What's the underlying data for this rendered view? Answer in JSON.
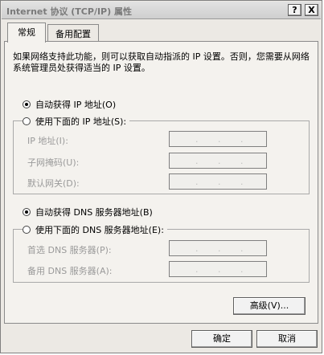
{
  "window": {
    "title": "Internet 协议 (TCP/IP) 属性",
    "help_label": "?",
    "close_label": "X"
  },
  "tabs": [
    {
      "label": "常规"
    },
    {
      "label": "备用配置"
    }
  ],
  "general": {
    "description": "如果网络支持此功能，则可以获取自动指派的 IP 设置。否则，您需要从网络系统管理员处获得适当的 IP 设置。",
    "ip_auto_label": "自动获得 IP 地址(O)",
    "ip_manual_label": "使用下面的 IP 地址(S):",
    "ip_mode_selected": "auto",
    "fields": {
      "ip_address_label": "IP 地址(I):",
      "subnet_mask_label": "子网掩码(U):",
      "gateway_label": "默认网关(D):"
    },
    "dns_auto_label": "自动获得 DNS 服务器地址(B)",
    "dns_manual_label": "使用下面的 DNS 服务器地址(E):",
    "dns_mode_selected": "auto",
    "dns_fields": {
      "preferred_label": "首选 DNS 服务器(P):",
      "alternate_label": "备用 DNS 服务器(A):"
    },
    "advanced_label": "高级(V)..."
  },
  "footer": {
    "ok_label": "确定",
    "cancel_label": "取消"
  }
}
